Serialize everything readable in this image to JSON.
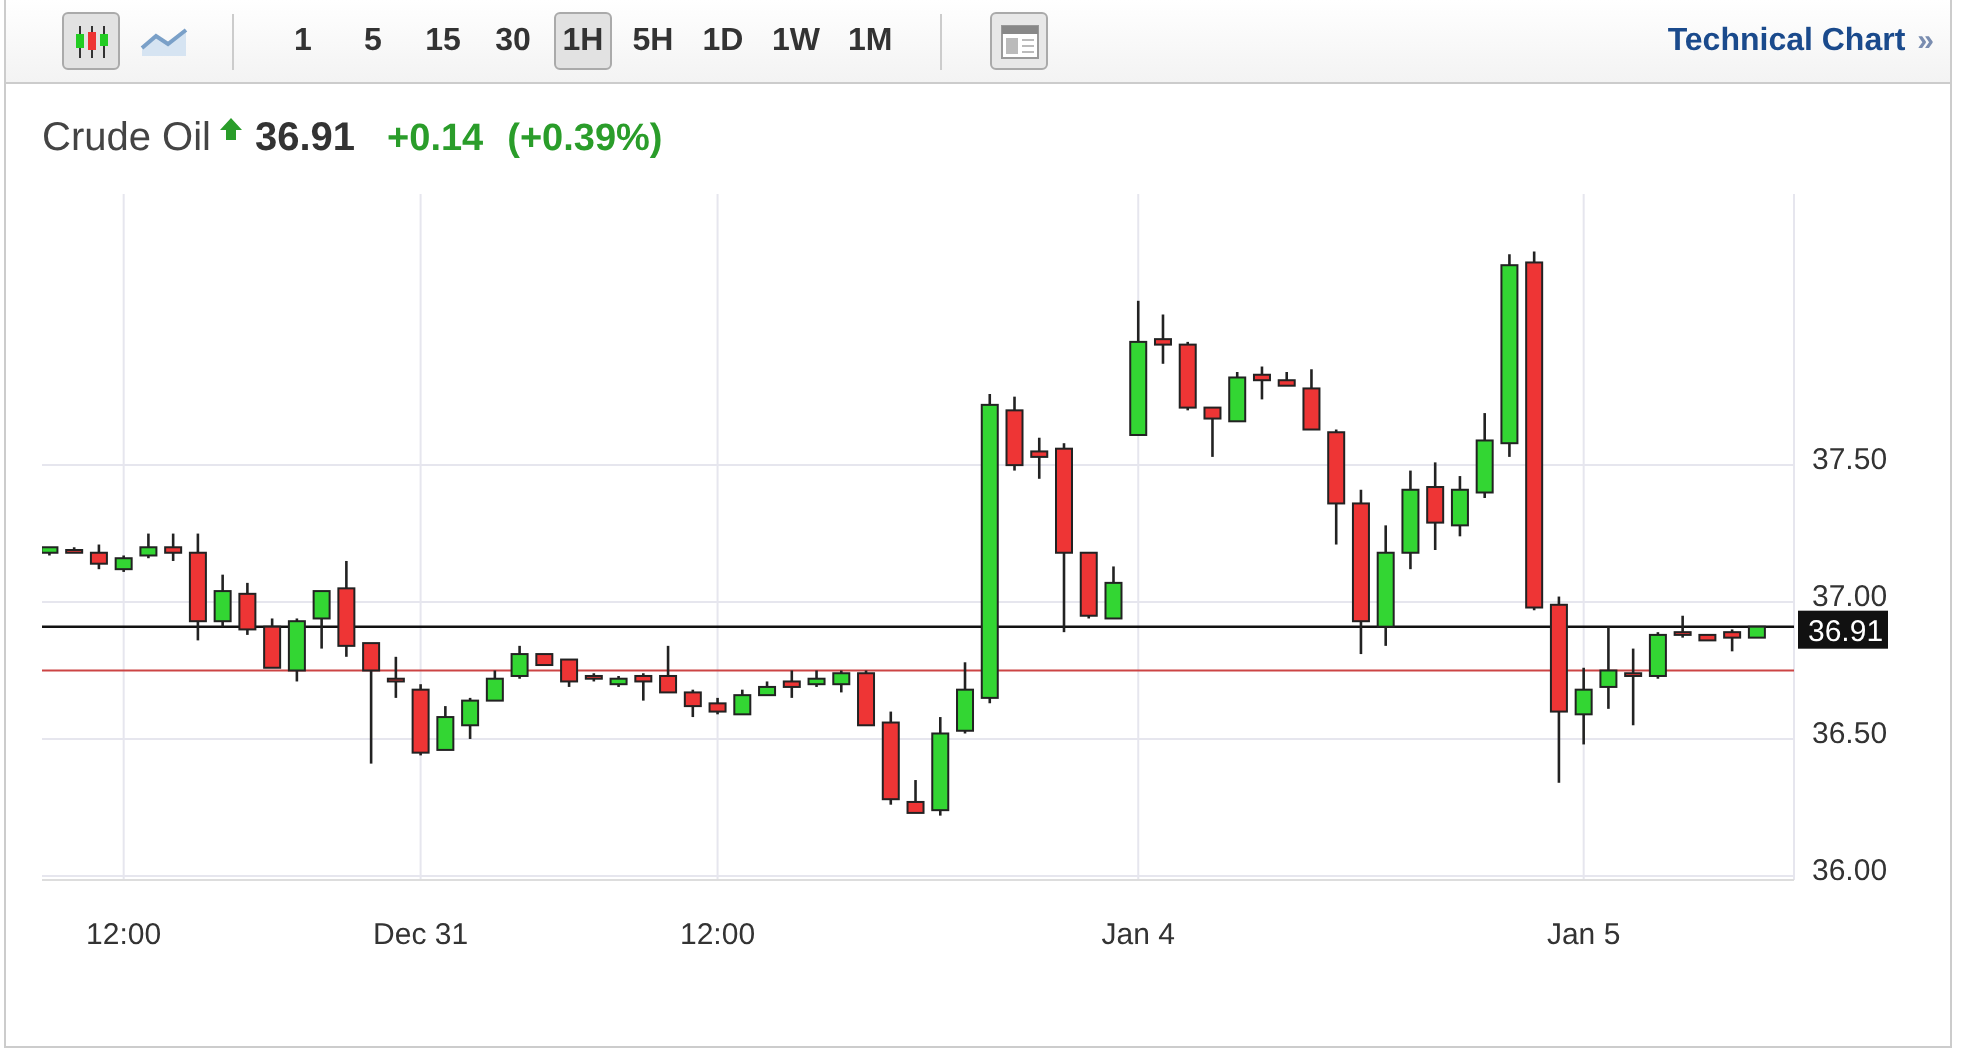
{
  "toolbar": {
    "chart_types": [
      {
        "kind": "candlestick",
        "selected": true
      },
      {
        "kind": "line",
        "selected": false
      }
    ],
    "intervals": [
      {
        "label": "1",
        "selected": false
      },
      {
        "label": "5",
        "selected": false
      },
      {
        "label": "15",
        "selected": false
      },
      {
        "label": "30",
        "selected": false
      },
      {
        "label": "1H",
        "selected": true
      },
      {
        "label": "5H",
        "selected": false
      },
      {
        "label": "1D",
        "selected": false
      },
      {
        "label": "1W",
        "selected": false
      },
      {
        "label": "1M",
        "selected": false
      }
    ],
    "technical_chart_link": {
      "label": "Technical Chart",
      "arrow": "»"
    }
  },
  "quote": {
    "name": "Crude Oil",
    "rising": true,
    "price": "36.91",
    "change": "+0.14",
    "change_percent": "(+0.39%)"
  },
  "chart_data": {
    "type": "candlestick",
    "ylim": [
      35.985,
      38.49
    ],
    "categories": [
      null,
      null,
      null,
      "12:00",
      null,
      null,
      null,
      null,
      null,
      null,
      null,
      null,
      null,
      null,
      null,
      "Dec 31",
      null,
      null,
      null,
      null,
      null,
      null,
      null,
      null,
      null,
      null,
      null,
      "12:00",
      null,
      null,
      null,
      null,
      null,
      null,
      null,
      null,
      null,
      null,
      null,
      null,
      null,
      null,
      null,
      null,
      "Jan 4",
      null,
      null,
      null,
      null,
      null,
      null,
      null,
      null,
      null,
      null,
      null,
      null,
      null,
      null,
      null,
      null,
      null,
      "Jan 5",
      null,
      null,
      null,
      null,
      null,
      null,
      null
    ],
    "yticks": [
      {
        "value": 36,
        "label": "36.00"
      },
      {
        "value": 36.5,
        "label": "36.50"
      },
      {
        "value": 37,
        "label": "37.00"
      },
      {
        "value": 37.5,
        "label": "37.50"
      }
    ],
    "grid": true,
    "ohlc": [
      [
        37.18,
        37.2,
        37.17,
        37.2
      ],
      [
        37.19,
        37.2,
        37.18,
        37.18
      ],
      [
        37.18,
        37.21,
        37.12,
        37.14
      ],
      [
        37.12,
        37.17,
        37.11,
        37.16
      ],
      [
        37.17,
        37.25,
        37.16,
        37.2
      ],
      [
        37.2,
        37.25,
        37.15,
        37.18
      ],
      [
        37.18,
        37.25,
        36.86,
        36.93
      ],
      [
        36.93,
        37.1,
        36.91,
        37.04
      ],
      [
        37.03,
        37.07,
        36.88,
        36.9
      ],
      [
        36.91,
        36.94,
        36.76,
        36.76
      ],
      [
        36.75,
        36.94,
        36.71,
        36.93
      ],
      [
        36.94,
        37.04,
        36.83,
        37.04
      ],
      [
        37.05,
        37.15,
        36.8,
        36.84
      ],
      [
        36.85,
        36.85,
        36.41,
        36.75
      ],
      [
        36.72,
        36.8,
        36.65,
        36.71
      ],
      [
        36.68,
        36.7,
        36.44,
        36.45
      ],
      [
        36.46,
        36.62,
        36.46,
        36.58
      ],
      [
        36.55,
        36.65,
        36.5,
        36.64
      ],
      [
        36.64,
        36.75,
        36.64,
        36.72
      ],
      [
        36.73,
        36.84,
        36.72,
        36.81
      ],
      [
        36.81,
        36.81,
        36.77,
        36.77
      ],
      [
        36.79,
        36.79,
        36.69,
        36.71
      ],
      [
        36.73,
        36.74,
        36.71,
        36.72
      ],
      [
        36.7,
        36.73,
        36.69,
        36.72
      ],
      [
        36.73,
        36.74,
        36.64,
        36.71
      ],
      [
        36.73,
        36.84,
        36.67,
        36.67
      ],
      [
        36.67,
        36.68,
        36.58,
        36.62
      ],
      [
        36.63,
        36.65,
        36.59,
        36.6
      ],
      [
        36.59,
        36.68,
        36.59,
        36.66
      ],
      [
        36.66,
        36.71,
        36.66,
        36.69
      ],
      [
        36.71,
        36.75,
        36.65,
        36.69
      ],
      [
        36.7,
        36.75,
        36.69,
        36.72
      ],
      [
        36.7,
        36.75,
        36.67,
        36.74
      ],
      [
        36.74,
        36.75,
        36.55,
        36.55
      ],
      [
        36.56,
        36.6,
        36.26,
        36.28
      ],
      [
        36.27,
        36.35,
        36.23,
        36.23
      ],
      [
        36.24,
        36.58,
        36.22,
        36.52
      ],
      [
        36.53,
        36.78,
        36.52,
        36.68
      ],
      [
        36.65,
        37.76,
        36.63,
        37.72
      ],
      [
        37.7,
        37.75,
        37.48,
        37.5
      ],
      [
        37.55,
        37.6,
        37.45,
        37.53
      ],
      [
        37.56,
        37.58,
        36.89,
        37.18
      ],
      [
        37.18,
        37.18,
        36.94,
        36.95
      ],
      [
        36.94,
        37.13,
        36.94,
        37.07
      ],
      [
        37.61,
        38.1,
        37.61,
        37.95
      ],
      [
        37.96,
        38.05,
        37.87,
        37.94
      ],
      [
        37.94,
        37.95,
        37.7,
        37.71
      ],
      [
        37.71,
        37.71,
        37.53,
        37.67
      ],
      [
        37.66,
        37.84,
        37.66,
        37.82
      ],
      [
        37.83,
        37.86,
        37.74,
        37.81
      ],
      [
        37.81,
        37.84,
        37.79,
        37.79
      ],
      [
        37.78,
        37.85,
        37.63,
        37.63
      ],
      [
        37.62,
        37.63,
        37.21,
        37.36
      ],
      [
        37.36,
        37.41,
        36.81,
        36.93
      ],
      [
        36.91,
        37.28,
        36.84,
        37.18
      ],
      [
        37.18,
        37.48,
        37.12,
        37.41
      ],
      [
        37.42,
        37.51,
        37.19,
        37.29
      ],
      [
        37.28,
        37.46,
        37.24,
        37.41
      ],
      [
        37.4,
        37.69,
        37.38,
        37.59
      ],
      [
        37.58,
        38.27,
        37.53,
        38.23
      ],
      [
        38.24,
        38.28,
        36.97,
        36.98
      ],
      [
        36.99,
        37.02,
        36.34,
        36.6
      ],
      [
        36.59,
        36.76,
        36.48,
        36.68
      ],
      [
        36.69,
        36.91,
        36.61,
        36.75
      ],
      [
        36.74,
        36.83,
        36.55,
        36.73
      ],
      [
        36.73,
        36.89,
        36.72,
        36.88
      ],
      [
        36.89,
        36.95,
        36.87,
        36.88
      ],
      [
        36.88,
        36.88,
        36.86,
        36.86
      ],
      [
        36.89,
        36.9,
        36.82,
        36.87
      ],
      [
        36.87,
        36.91,
        36.87,
        36.91
      ]
    ],
    "ref_lines": [
      {
        "axis": "y",
        "value": 36.91,
        "label": "36.91",
        "color": "#111111"
      },
      {
        "axis": "y",
        "value": 36.75,
        "color": "#cc4444"
      }
    ]
  }
}
